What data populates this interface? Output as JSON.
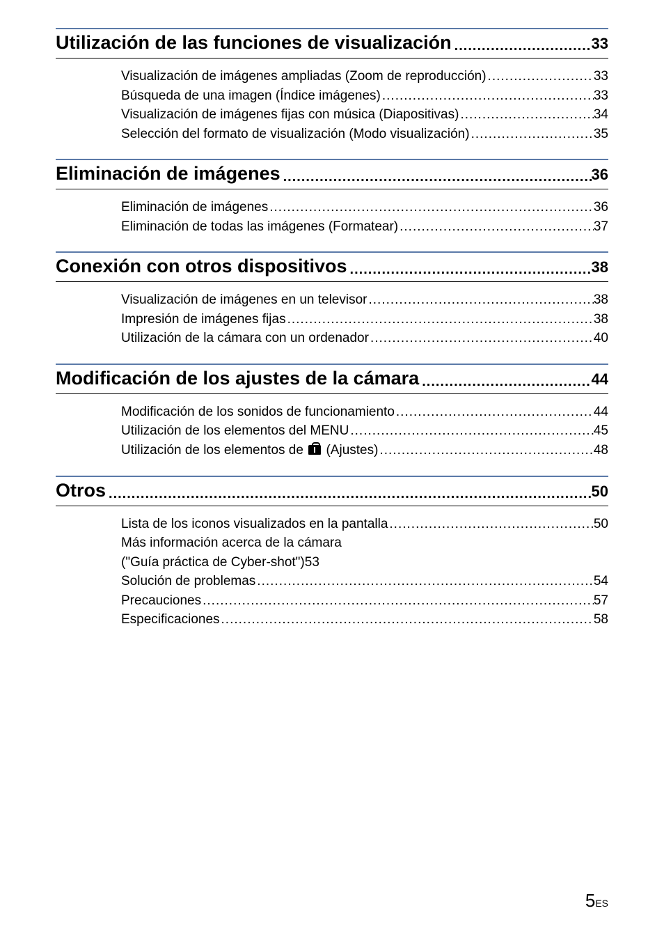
{
  "sections": [
    {
      "title": "Utilización de las funciones de visualización",
      "page": "33",
      "entries": [
        {
          "label": "Visualización de imágenes ampliadas (Zoom de reproducción)",
          "page": "33"
        },
        {
          "label": "Búsqueda de una imagen (Índice imágenes)",
          "page": "33"
        },
        {
          "label": "Visualización de imágenes fijas con música (Diapositivas)",
          "page": "34"
        },
        {
          "label": "Selección del formato de visualización (Modo visualización)",
          "page": "35"
        }
      ]
    },
    {
      "title": "Eliminación de imágenes",
      "page": "36",
      "entries": [
        {
          "label": "Eliminación de imágenes",
          "page": "36"
        },
        {
          "label": "Eliminación de todas las imágenes (Formatear)",
          "page": "37"
        }
      ]
    },
    {
      "title": "Conexión con otros dispositivos",
      "page": "38",
      "entries": [
        {
          "label": "Visualización de imágenes en un televisor",
          "page": "38"
        },
        {
          "label": "Impresión de imágenes fijas",
          "page": "38"
        },
        {
          "label": "Utilización de la cámara con un ordenador",
          "page": "40"
        }
      ]
    },
    {
      "title": "Modificación de los ajustes de la cámara",
      "page": "44",
      "entries": [
        {
          "label": "Modificación de los sonidos de funcionamiento",
          "page": "44"
        },
        {
          "label": "Utilización de los elementos del MENU",
          "page": "45"
        },
        {
          "label_pre": "Utilización de los elementos de ",
          "icon": true,
          "label_post": " (Ajustes)",
          "page": "48"
        }
      ]
    },
    {
      "title": "Otros",
      "page": "50",
      "entries": [
        {
          "label": "Lista de los iconos visualizados en la pantalla",
          "page": "50"
        },
        {
          "multiline": true,
          "line1": "Más información acerca de la cámara",
          "line2": "(\"Guía práctica de Cyber-shot\")",
          "page": "53"
        },
        {
          "label": "Solución de problemas",
          "page": "54"
        },
        {
          "label": "Precauciones",
          "page": "57"
        },
        {
          "label": "Especificaciones",
          "page": "58"
        }
      ]
    }
  ],
  "footer": {
    "num": "5",
    "suffix": "ES"
  }
}
